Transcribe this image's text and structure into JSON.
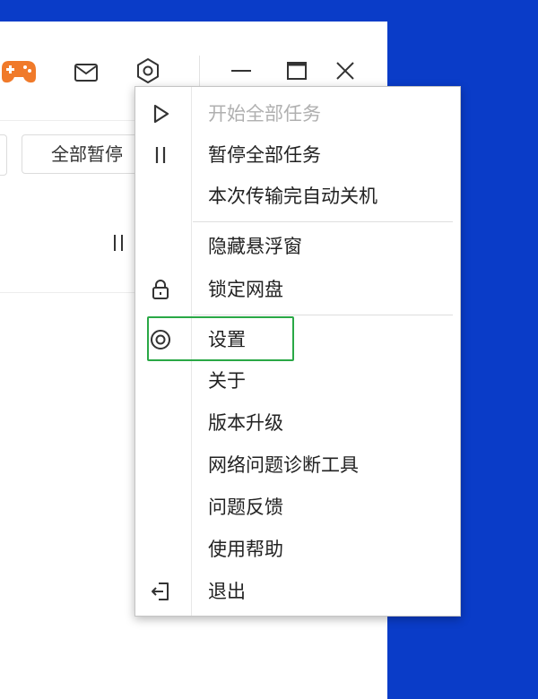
{
  "toolbar": {
    "pause_all_button": "全部暂停"
  },
  "menu": {
    "items": [
      {
        "label": "开始全部任务",
        "icon": "play-icon",
        "disabled": true
      },
      {
        "label": "暂停全部任务",
        "icon": "pause-icon",
        "disabled": false
      },
      {
        "label": "本次传输完自动关机",
        "icon": "",
        "disabled": false
      },
      {
        "label": "隐藏悬浮窗",
        "icon": "",
        "disabled": false
      },
      {
        "label": "锁定网盘",
        "icon": "lock-icon",
        "disabled": false
      },
      {
        "label": "设置",
        "icon": "settings-icon",
        "disabled": false
      },
      {
        "label": "关于",
        "icon": "",
        "disabled": false
      },
      {
        "label": "版本升级",
        "icon": "",
        "disabled": false
      },
      {
        "label": "网络问题诊断工具",
        "icon": "",
        "disabled": false
      },
      {
        "label": "问题反馈",
        "icon": "",
        "disabled": false
      },
      {
        "label": "使用帮助",
        "icon": "",
        "disabled": false
      },
      {
        "label": "退出",
        "icon": "exit-icon",
        "disabled": false
      }
    ]
  },
  "highlight": {
    "target": "设置",
    "color": "#2aa846"
  },
  "colors": {
    "desktop": "#0a3cc8",
    "game_icon": "#f07a2a"
  }
}
